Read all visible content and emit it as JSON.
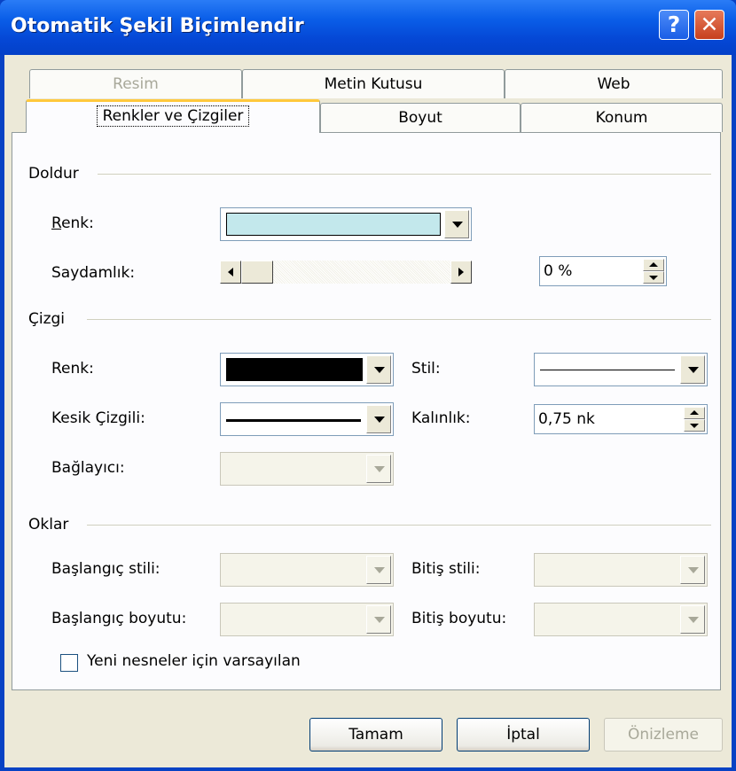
{
  "window": {
    "title": "Otomatik Şekil Biçimlendir",
    "help_label": "?",
    "close_label": "✕"
  },
  "tabs": {
    "row1": [
      {
        "label": "Resim",
        "disabled": true
      },
      {
        "label": "Metin Kutusu"
      },
      {
        "label": "Web"
      }
    ],
    "row2": [
      {
        "label": "Renkler ve Çizgiler",
        "active": true
      },
      {
        "label": "Boyut"
      },
      {
        "label": "Konum"
      }
    ]
  },
  "fill": {
    "group_label": "Doldur",
    "color_label": "Renk:",
    "color_value": "#c3e8ec",
    "transparency_label": "Saydamlık:",
    "transparency_value": "0 %",
    "transparency_level": 0
  },
  "line": {
    "group_label": "Çizgi",
    "color_label": "Renk:",
    "color_value": "#000000",
    "style_label": "Stil:",
    "dashed_label": "Kesik Çizgili:",
    "weight_label": "Kalınlık:",
    "weight_value": "0,75 nk",
    "connector_label": "Bağlayıcı:"
  },
  "arrows": {
    "group_label": "Oklar",
    "begin_style_label": "Başlangıç stili:",
    "end_style_label": "Bitiş stili:",
    "begin_size_label": "Başlangıç boyutu:",
    "end_size_label": "Bitiş boyutu:"
  },
  "default_checkbox": {
    "label": "Yeni nesneler için varsayılan",
    "checked": false
  },
  "buttons": {
    "ok": "Tamam",
    "cancel": "İptal",
    "preview": "Önizleme"
  }
}
